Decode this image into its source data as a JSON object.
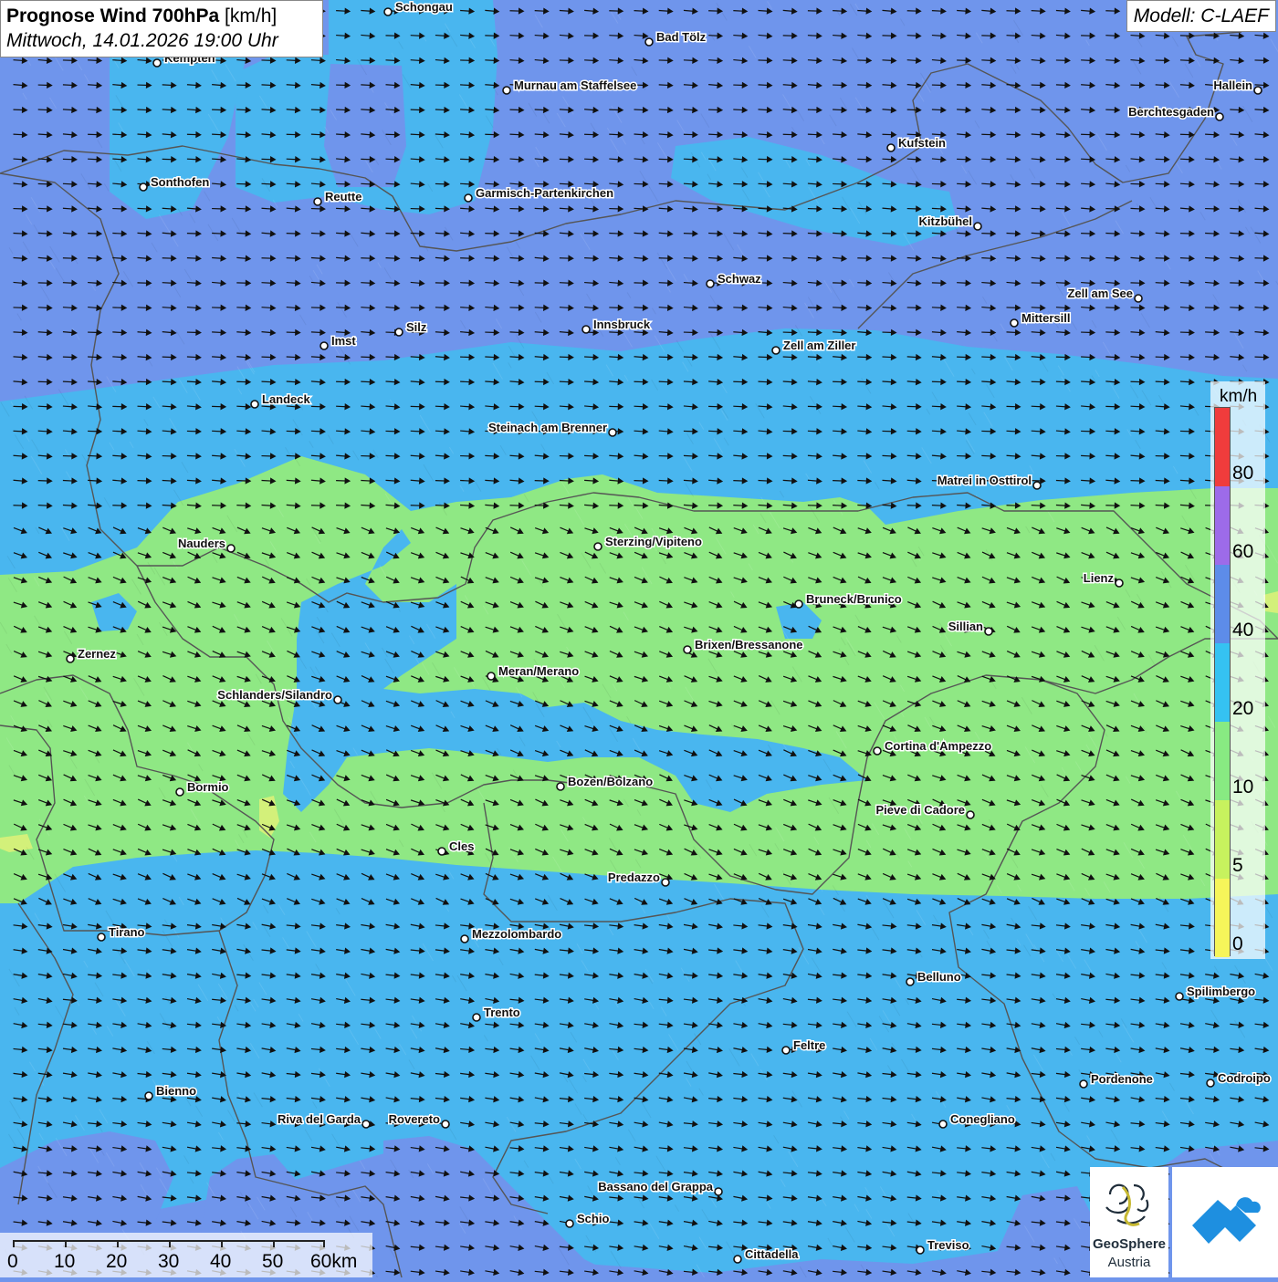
{
  "header": {
    "title_bold": "Prognose Wind 700hPa",
    "title_unit": "[km/h]",
    "datetime": "Mittwoch, 14.01.2026 19:00 Uhr",
    "model": "Modell: C-LAEF"
  },
  "legend": {
    "unit": "km/h",
    "labels": [
      "80",
      "60",
      "40",
      "20",
      "10",
      "5",
      "0"
    ],
    "colors": [
      "#f03c3c",
      "#9d6be9",
      "#5d8ce9",
      "#35c2f2",
      "#88ea82",
      "#c7f25e",
      "#f6f55a"
    ]
  },
  "scalebar": {
    "labels": [
      "0",
      "10",
      "20",
      "30",
      "40",
      "50",
      "60km"
    ]
  },
  "logos": {
    "brand": "GeoSphere",
    "sub": "Austria"
  },
  "map_colors": {
    "wind_30_40": "#6f95ec",
    "wind_20_30": "#3fb9ef",
    "wind_10_20": "#8fe884",
    "wind_5_10": "#d3f07a",
    "borders": "#555555"
  },
  "cities": [
    {
      "name": "Schongau"
    },
    {
      "name": "Bad Tölz"
    },
    {
      "name": "Kempten"
    },
    {
      "name": "Murnau am Staffelsee"
    },
    {
      "name": "Hallein"
    },
    {
      "name": "Berchtesgaden"
    },
    {
      "name": "Kufstein"
    },
    {
      "name": "Sonthofen"
    },
    {
      "name": "Reutte"
    },
    {
      "name": "Garmisch-Partenkirchen"
    },
    {
      "name": "Kitzbühel"
    },
    {
      "name": "Schwaz"
    },
    {
      "name": "Zell am See"
    },
    {
      "name": "Mittersill"
    },
    {
      "name": "Innsbruck"
    },
    {
      "name": "Silz"
    },
    {
      "name": "Imst"
    },
    {
      "name": "Zell am Ziller"
    },
    {
      "name": "Landeck"
    },
    {
      "name": "Steinach am Brenner"
    },
    {
      "name": "Matrei in Osttirol"
    },
    {
      "name": "Nauders"
    },
    {
      "name": "Sterzing/Vipiteno"
    },
    {
      "name": "Lienz"
    },
    {
      "name": "Bruneck/Brunico"
    },
    {
      "name": "Sillian"
    },
    {
      "name": "Brixen/Bressanone"
    },
    {
      "name": "Zernez"
    },
    {
      "name": "Meran/Merano"
    },
    {
      "name": "Schlanders/Silandro"
    },
    {
      "name": "Cortina d'Ampezzo"
    },
    {
      "name": "Bozen/Bolzano"
    },
    {
      "name": "Bormio"
    },
    {
      "name": "Pieve di Cadore"
    },
    {
      "name": "Cles"
    },
    {
      "name": "Predazzo"
    },
    {
      "name": "Tirano"
    },
    {
      "name": "Mezzolombardo"
    },
    {
      "name": "Belluno"
    },
    {
      "name": "Spilimbergo"
    },
    {
      "name": "Trento"
    },
    {
      "name": "Feltre"
    },
    {
      "name": "Bienno"
    },
    {
      "name": "Pordenone"
    },
    {
      "name": "Codroipo"
    },
    {
      "name": "Riva del Garda"
    },
    {
      "name": "Rovereto"
    },
    {
      "name": "Conegliano"
    },
    {
      "name": "Bassano del Grappa"
    },
    {
      "name": "Schio"
    },
    {
      "name": "Treviso"
    },
    {
      "name": "Cittadella"
    }
  ]
}
